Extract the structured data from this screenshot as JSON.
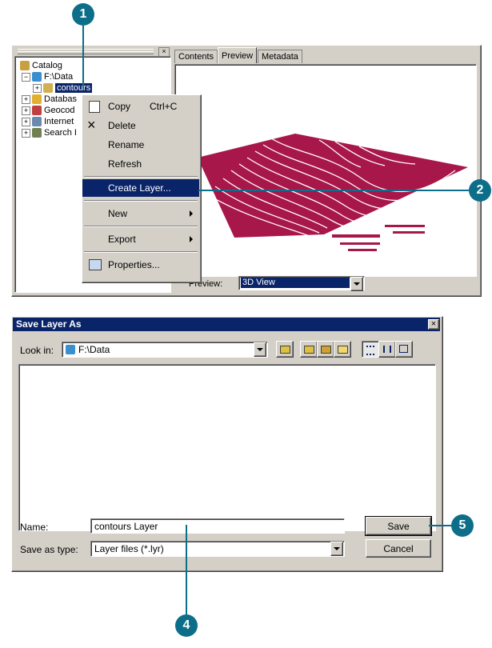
{
  "callouts": {
    "c1": "1",
    "c2": "2",
    "c4": "4",
    "c5": "5"
  },
  "catalog": {
    "items": [
      {
        "label": "Catalog"
      },
      {
        "label": "F:\\Data"
      },
      {
        "label": "contours"
      },
      {
        "label": "Databas"
      },
      {
        "label": "Geocod"
      },
      {
        "label": "Internet"
      },
      {
        "label": "Search I"
      }
    ]
  },
  "tabs": [
    {
      "label": "Contents"
    },
    {
      "label": "Preview"
    },
    {
      "label": "Metadata"
    }
  ],
  "preview": {
    "label": "Preview:",
    "view": "3D View",
    "surface_color": "#a8174a"
  },
  "context_menu": {
    "copy": "Copy",
    "copy_shortcut": "Ctrl+C",
    "delete": "Delete",
    "rename": "Rename",
    "refresh": "Refresh",
    "create_layer": "Create Layer...",
    "new": "New",
    "export": "Export",
    "properties": "Properties..."
  },
  "dialog": {
    "title": "Save Layer As",
    "close": "×",
    "look_in_label": "Look in:",
    "look_in_value": "F:\\Data",
    "name_label": "Name:",
    "name_value": "contours Layer",
    "type_label": "Save as type:",
    "type_value": "Layer files (*.lyr)",
    "save": "Save",
    "cancel": "Cancel"
  },
  "colors": {
    "accent": "#0d6e8a",
    "title_bar": "#0a246a",
    "highlight": "#0a246a"
  }
}
